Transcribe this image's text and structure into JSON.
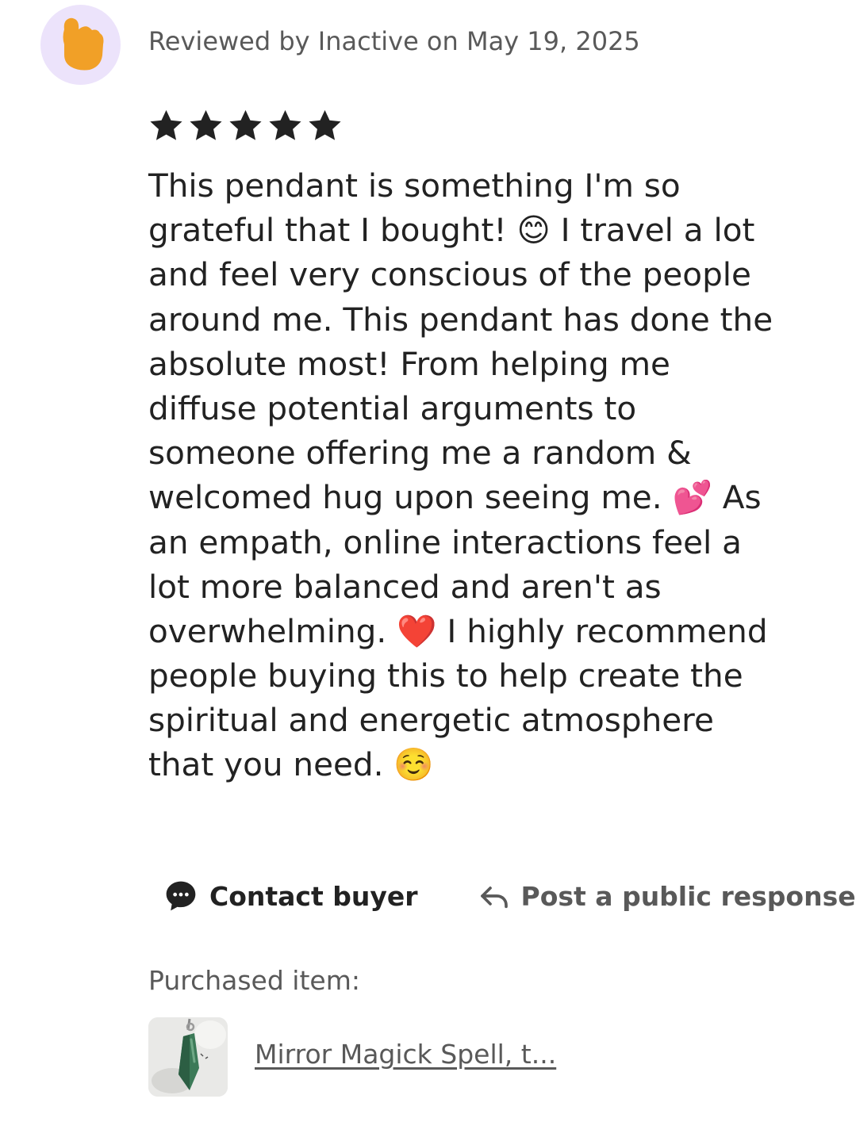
{
  "review": {
    "header_text": "Reviewed by Inactive on May 19, 2025",
    "rating": 5,
    "max_rating": 5,
    "star_color": "#222222",
    "text_lines": [
      "This pendant is something I'm so",
      "grateful that I bought! 😊 I travel a lot",
      "and feel very conscious of the people",
      "around me. This pendant has done the",
      "absolute most! From helping me",
      "diffuse potential arguments to",
      "someone offering me a random &",
      "welcomed hug upon seeing me. 💕 As",
      "an empath, online interactions feel a",
      "lot more balanced and aren't as",
      "overwhelming. ❤️ I highly recommend",
      "people buying this to help create the",
      "spiritual and energetic atmosphere",
      "that you need. ☺️"
    ]
  },
  "avatar": {
    "icon": "hand-icon",
    "bg_color": "#ece3fb",
    "icon_color": "#f1a027"
  },
  "actions": {
    "contact_label": "Contact buyer",
    "respond_label": "Post a public response"
  },
  "purchase": {
    "label": "Purchased item:",
    "item_title": "Mirror Magick Spell, t...",
    "thumbnail": "green-crystal-pendant-image"
  }
}
